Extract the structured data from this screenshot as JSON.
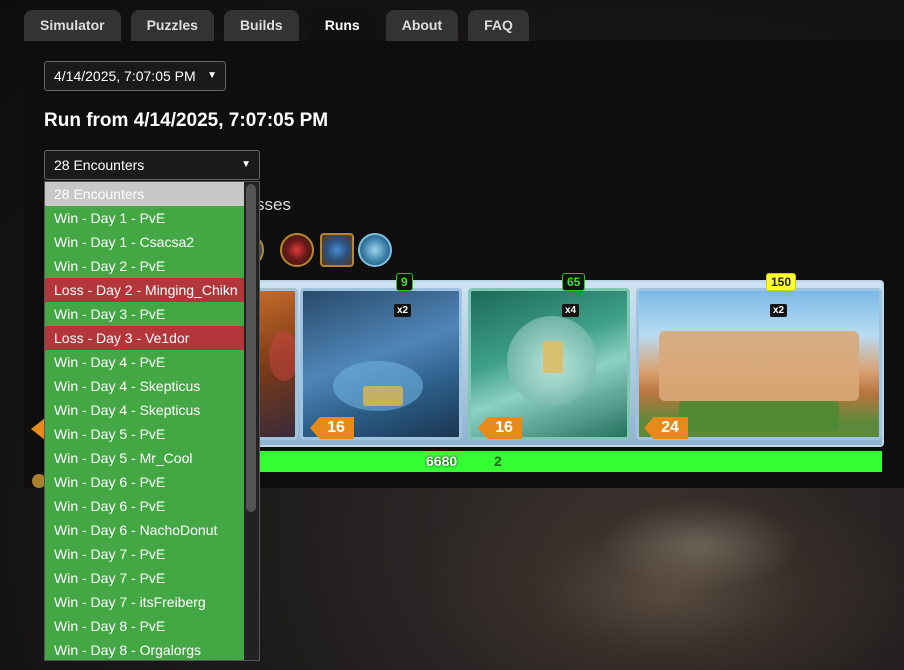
{
  "tabs": [
    "Simulator",
    "Puzzles",
    "Builds",
    "Runs",
    "About",
    "FAQ"
  ],
  "active_tab": "Runs",
  "run_select": {
    "value": "4/14/2025, 7:07:05 PM"
  },
  "run_title": "Run from 4/14/2025, 7:07:05 PM",
  "encounter_select": {
    "value": "28 Encounters"
  },
  "partial_text": "sses",
  "board": {
    "cards": [
      {
        "name": "card-1",
        "tier_value": "",
        "multiplier": "",
        "cooldown": ""
      },
      {
        "name": "card-2",
        "tier_value": "9",
        "multiplier": "x2",
        "cooldown": "16"
      },
      {
        "name": "card-3",
        "tier_value": "65",
        "multiplier": "x4",
        "cooldown": "16"
      },
      {
        "name": "card-4",
        "tier_value": "150",
        "multiplier": "x2",
        "cooldown": "24"
      }
    ],
    "health": "6680",
    "shield": "2"
  },
  "dropdown": {
    "options": [
      {
        "label": "28 Encounters",
        "kind": "selected"
      },
      {
        "label": "Win - Day 1 - PvE",
        "kind": "win"
      },
      {
        "label": "Win - Day 1 - Csacsa2",
        "kind": "win"
      },
      {
        "label": "Win - Day 2 - PvE",
        "kind": "win"
      },
      {
        "label": "Loss - Day 2 - Minging_Chikn",
        "kind": "loss"
      },
      {
        "label": "Win - Day 3 - PvE",
        "kind": "win"
      },
      {
        "label": "Loss - Day 3 - Ve1dor",
        "kind": "loss"
      },
      {
        "label": "Win - Day 4 - PvE",
        "kind": "win"
      },
      {
        "label": "Win - Day 4 - Skepticus",
        "kind": "win"
      },
      {
        "label": "Win - Day 4 - Skepticus",
        "kind": "win"
      },
      {
        "label": "Win - Day 5 - PvE",
        "kind": "win"
      },
      {
        "label": "Win - Day 5 - Mr_Cool",
        "kind": "win"
      },
      {
        "label": "Win - Day 6 - PvE",
        "kind": "win"
      },
      {
        "label": "Win - Day 6 - PvE",
        "kind": "win"
      },
      {
        "label": "Win - Day 6 - NachoDonut",
        "kind": "win"
      },
      {
        "label": "Win - Day 7 - PvE",
        "kind": "win"
      },
      {
        "label": "Win - Day 7 - PvE",
        "kind": "win"
      },
      {
        "label": "Win - Day 7 - itsFreiberg",
        "kind": "win"
      },
      {
        "label": "Win - Day 8 - PvE",
        "kind": "win"
      },
      {
        "label": "Win - Day 8 - Orgalorgs",
        "kind": "win"
      }
    ]
  },
  "colors": {
    "win": "#43a843",
    "loss": "#b3363b",
    "selected": "#c8c8c8",
    "health_bar": "#33ff33",
    "cooldown_badge": "#e88a1a"
  },
  "icons": [
    "relic-icon",
    "chevron-down-icon"
  ]
}
